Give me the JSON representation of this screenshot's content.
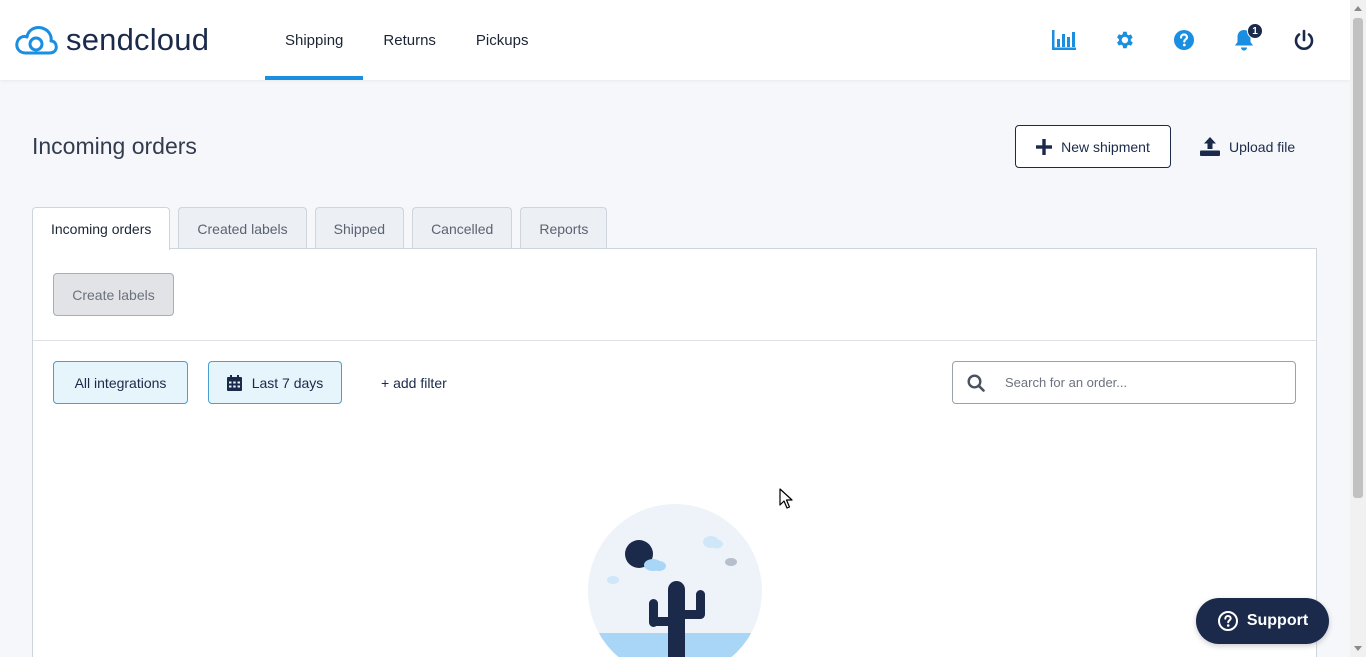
{
  "brand": {
    "name": "sendcloud"
  },
  "nav": {
    "items": [
      {
        "label": "Shipping",
        "active": true
      },
      {
        "label": "Returns",
        "active": false
      },
      {
        "label": "Pickups",
        "active": false
      }
    ]
  },
  "top_icons": {
    "analytics": "bar-chart-icon",
    "settings": "gear-icon",
    "help": "question-icon",
    "notifications": "bell-icon",
    "notifications_count": "1",
    "logout": "power-icon"
  },
  "page": {
    "title": "Incoming orders"
  },
  "actions": {
    "new_shipment": "New shipment",
    "upload_file": "Upload file"
  },
  "tabs": [
    {
      "label": "Incoming orders",
      "active": true
    },
    {
      "label": "Created labels",
      "active": false
    },
    {
      "label": "Shipped",
      "active": false
    },
    {
      "label": "Cancelled",
      "active": false
    },
    {
      "label": "Reports",
      "active": false
    }
  ],
  "toolbar": {
    "create_labels": "Create labels"
  },
  "filters": {
    "integrations": "All integrations",
    "date_range": "Last 7 days",
    "add_filter": "+ add filter"
  },
  "search": {
    "placeholder": "Search for an order...",
    "value": ""
  },
  "support": {
    "label": "Support"
  },
  "colors": {
    "brand_navy": "#1b2a4a",
    "accent_blue": "#1a8ee1",
    "filter_bg": "#e6f4fb"
  }
}
